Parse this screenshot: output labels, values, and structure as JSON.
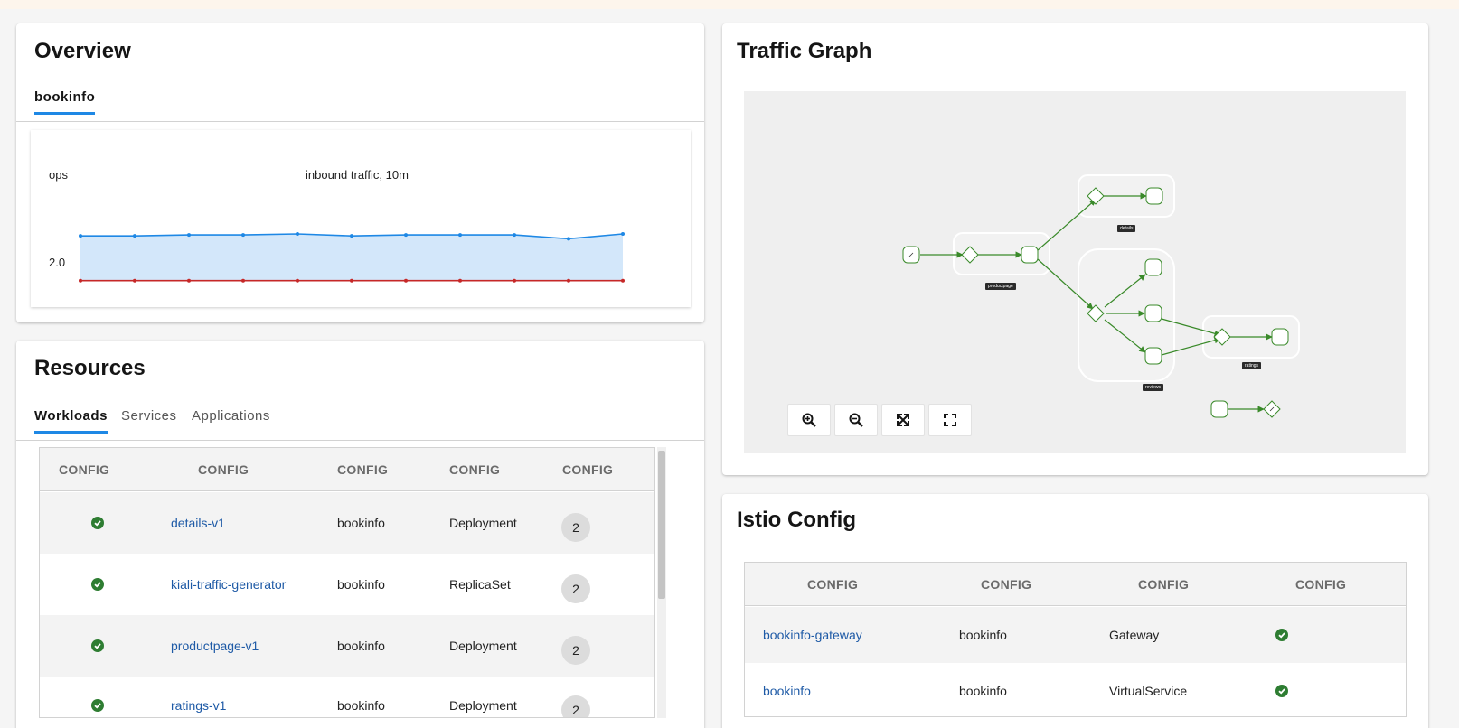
{
  "overview": {
    "title": "Overview",
    "tab": "bookinfo",
    "chart_data": {
      "type": "area",
      "title": "inbound traffic, 10m",
      "ylabel": "ops",
      "yticks": [
        "2.0"
      ],
      "ylim": [
        1.5,
        2.8
      ],
      "series": [
        {
          "color": "#1e88e5",
          "fill": "#d3e7fa",
          "values": [
            2.13,
            2.13,
            2.14,
            2.14,
            2.15,
            2.13,
            2.14,
            2.14,
            2.14,
            2.1,
            2.15
          ]
        },
        {
          "color": "#c62828",
          "values": [
            1.67,
            1.67,
            1.67,
            1.67,
            1.67,
            1.67,
            1.67,
            1.67,
            1.67,
            1.67,
            1.67
          ]
        }
      ]
    }
  },
  "resources": {
    "title": "Resources",
    "tabs": [
      "Workloads",
      "Services",
      "Applications"
    ],
    "columns": [
      "CONFIG",
      "CONFIG",
      "CONFIG",
      "CONFIG",
      "CONFIG"
    ],
    "rows": [
      {
        "name": "details-v1",
        "namespace": "bookinfo",
        "type": "Deployment",
        "count": "2"
      },
      {
        "name": "kiali-traffic-generator",
        "namespace": "bookinfo",
        "type": "ReplicaSet",
        "count": "2"
      },
      {
        "name": "productpage-v1",
        "namespace": "bookinfo",
        "type": "Deployment",
        "count": "2"
      },
      {
        "name": "ratings-v1",
        "namespace": "bookinfo",
        "type": "Deployment",
        "count": "2"
      }
    ]
  },
  "traffic_graph": {
    "title": "Traffic Graph",
    "labels": [
      "details",
      "productpage",
      "reviews",
      "ratings"
    ],
    "controls": [
      "zoom-in-icon",
      "zoom-out-icon",
      "fit-icon",
      "fullscreen-icon"
    ],
    "edge_color": "#3a8a2a"
  },
  "istio_config": {
    "title": "Istio Config",
    "columns": [
      "CONFIG",
      "CONFIG",
      "CONFIG",
      "CONFIG"
    ],
    "rows": [
      {
        "name": "bookinfo-gateway",
        "namespace": "bookinfo",
        "type": "Gateway"
      },
      {
        "name": "bookinfo",
        "namespace": "bookinfo",
        "type": "VirtualService"
      }
    ]
  },
  "colors": {
    "accent": "#1e88e5",
    "link": "#1e5aa6",
    "success": "#2e7d32"
  }
}
